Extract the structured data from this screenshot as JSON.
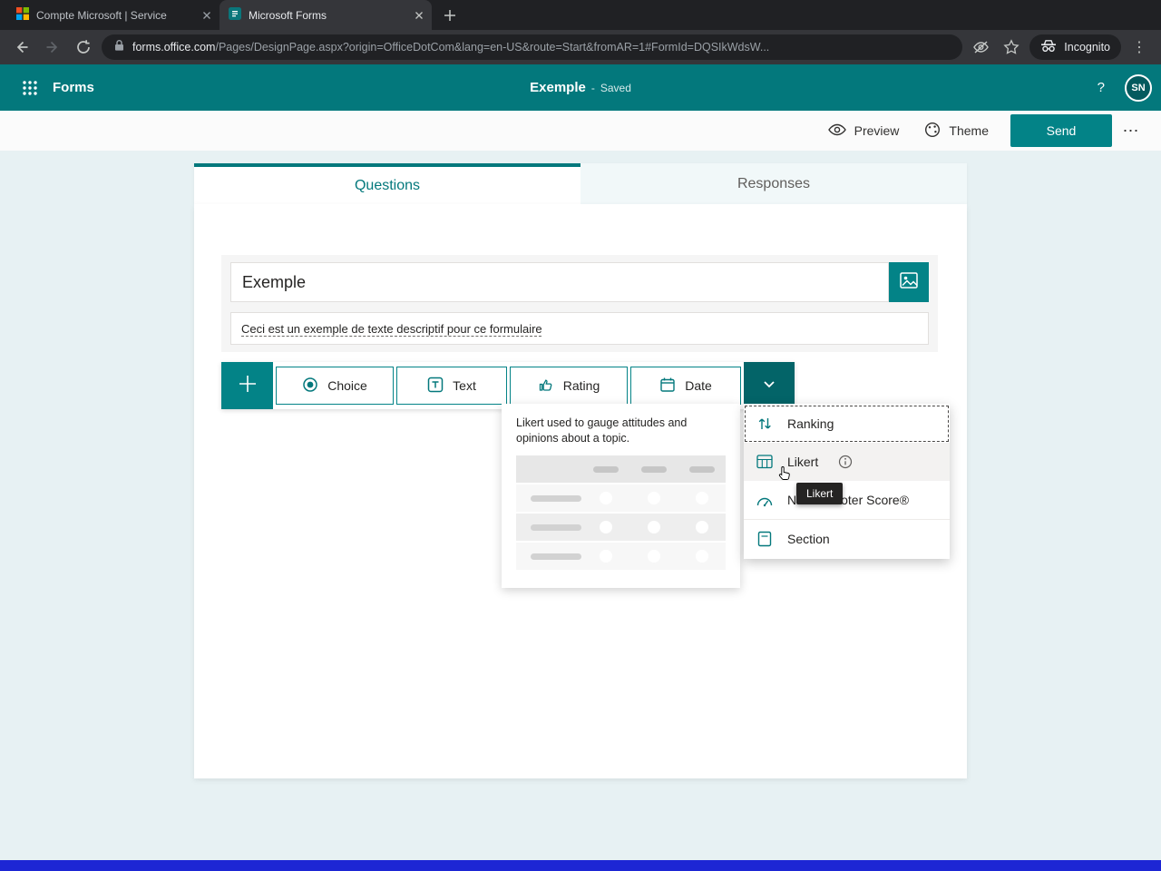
{
  "browser": {
    "tabs": [
      {
        "title": "Compte Microsoft | Service"
      },
      {
        "title": "Microsoft Forms"
      }
    ],
    "url": {
      "domain": "forms.office.com",
      "path": "/Pages/DesignPage.aspx?origin=OfficeDotCom&lang=en-US&route=Start&fromAR=1#FormId=DQSIkWdsW..."
    },
    "incognito_label": "Incognito"
  },
  "app_header": {
    "app_name": "Forms",
    "doc_title": "Exemple",
    "separator": "-",
    "status": "Saved",
    "help_label": "?",
    "avatar_initials": "SN"
  },
  "command_bar": {
    "preview": "Preview",
    "theme": "Theme",
    "send": "Send"
  },
  "view_tabs": {
    "questions": "Questions",
    "responses": "Responses"
  },
  "form": {
    "title_value": "Exemple",
    "description": "Ceci est un exemple de texte descriptif pour ce formulaire"
  },
  "add_question_bar": {
    "choice": "Choice",
    "text": "Text",
    "rating": "Rating",
    "date": "Date"
  },
  "question_type_menu": {
    "items": [
      {
        "label": "Ranking"
      },
      {
        "label": "Likert"
      },
      {
        "label": "Net Promoter Score®"
      },
      {
        "label": "Section"
      }
    ]
  },
  "likert_flyout": {
    "description": "Likert used to gauge attitudes and opinions about a topic."
  },
  "tooltip": {
    "label": "Likert"
  },
  "colors": {
    "teal": "#03787c",
    "teal_button": "#038387",
    "teal_pressed": "#036468",
    "content_bg": "#e7f1f3",
    "chrome_dark": "#202124",
    "chrome_mid": "#35363a",
    "bottom_strip": "#1d26d4"
  }
}
